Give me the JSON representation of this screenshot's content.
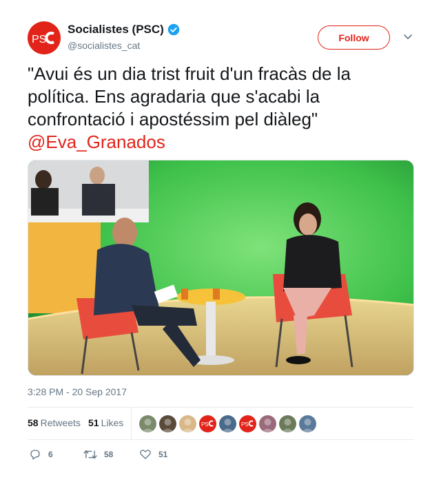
{
  "account": {
    "display_name": "Socialistes (PSC)",
    "handle": "@socialistes_cat",
    "avatar_text": "PSC",
    "verified": true
  },
  "follow_label": "Follow",
  "tweet": {
    "text": "\"Avui és un dia trist fruit d'un fracàs de la política. Ens agradaria que s'acabi la confrontació i apostéssim pel diàleg\"",
    "mention": "@Eva_Granados"
  },
  "timestamp": "3:28 PM - 20 Sep 2017",
  "stats": {
    "retweets_count": "58",
    "retweets_label": "Retweets",
    "likes_count": "51",
    "likes_label": "Likes"
  },
  "actions": {
    "reply_count": "6",
    "retweet_count": "58",
    "like_count": "51"
  },
  "likers": [
    {
      "type": "photo",
      "color": "#7a8a6a"
    },
    {
      "type": "photo",
      "color": "#5a4a3a"
    },
    {
      "type": "photo",
      "color": "#d8b888"
    },
    {
      "type": "psc",
      "color": "#e2231a"
    },
    {
      "type": "photo",
      "color": "#4a6a8a"
    },
    {
      "type": "psc",
      "color": "#e2231a"
    },
    {
      "type": "photo",
      "color": "#9a6a7a"
    },
    {
      "type": "photo",
      "color": "#6a7a5a"
    },
    {
      "type": "photo",
      "color": "#5a7a9a"
    }
  ],
  "colors": {
    "brand": "#e2231a",
    "verified": "#1da1f2",
    "muted": "#657786"
  }
}
